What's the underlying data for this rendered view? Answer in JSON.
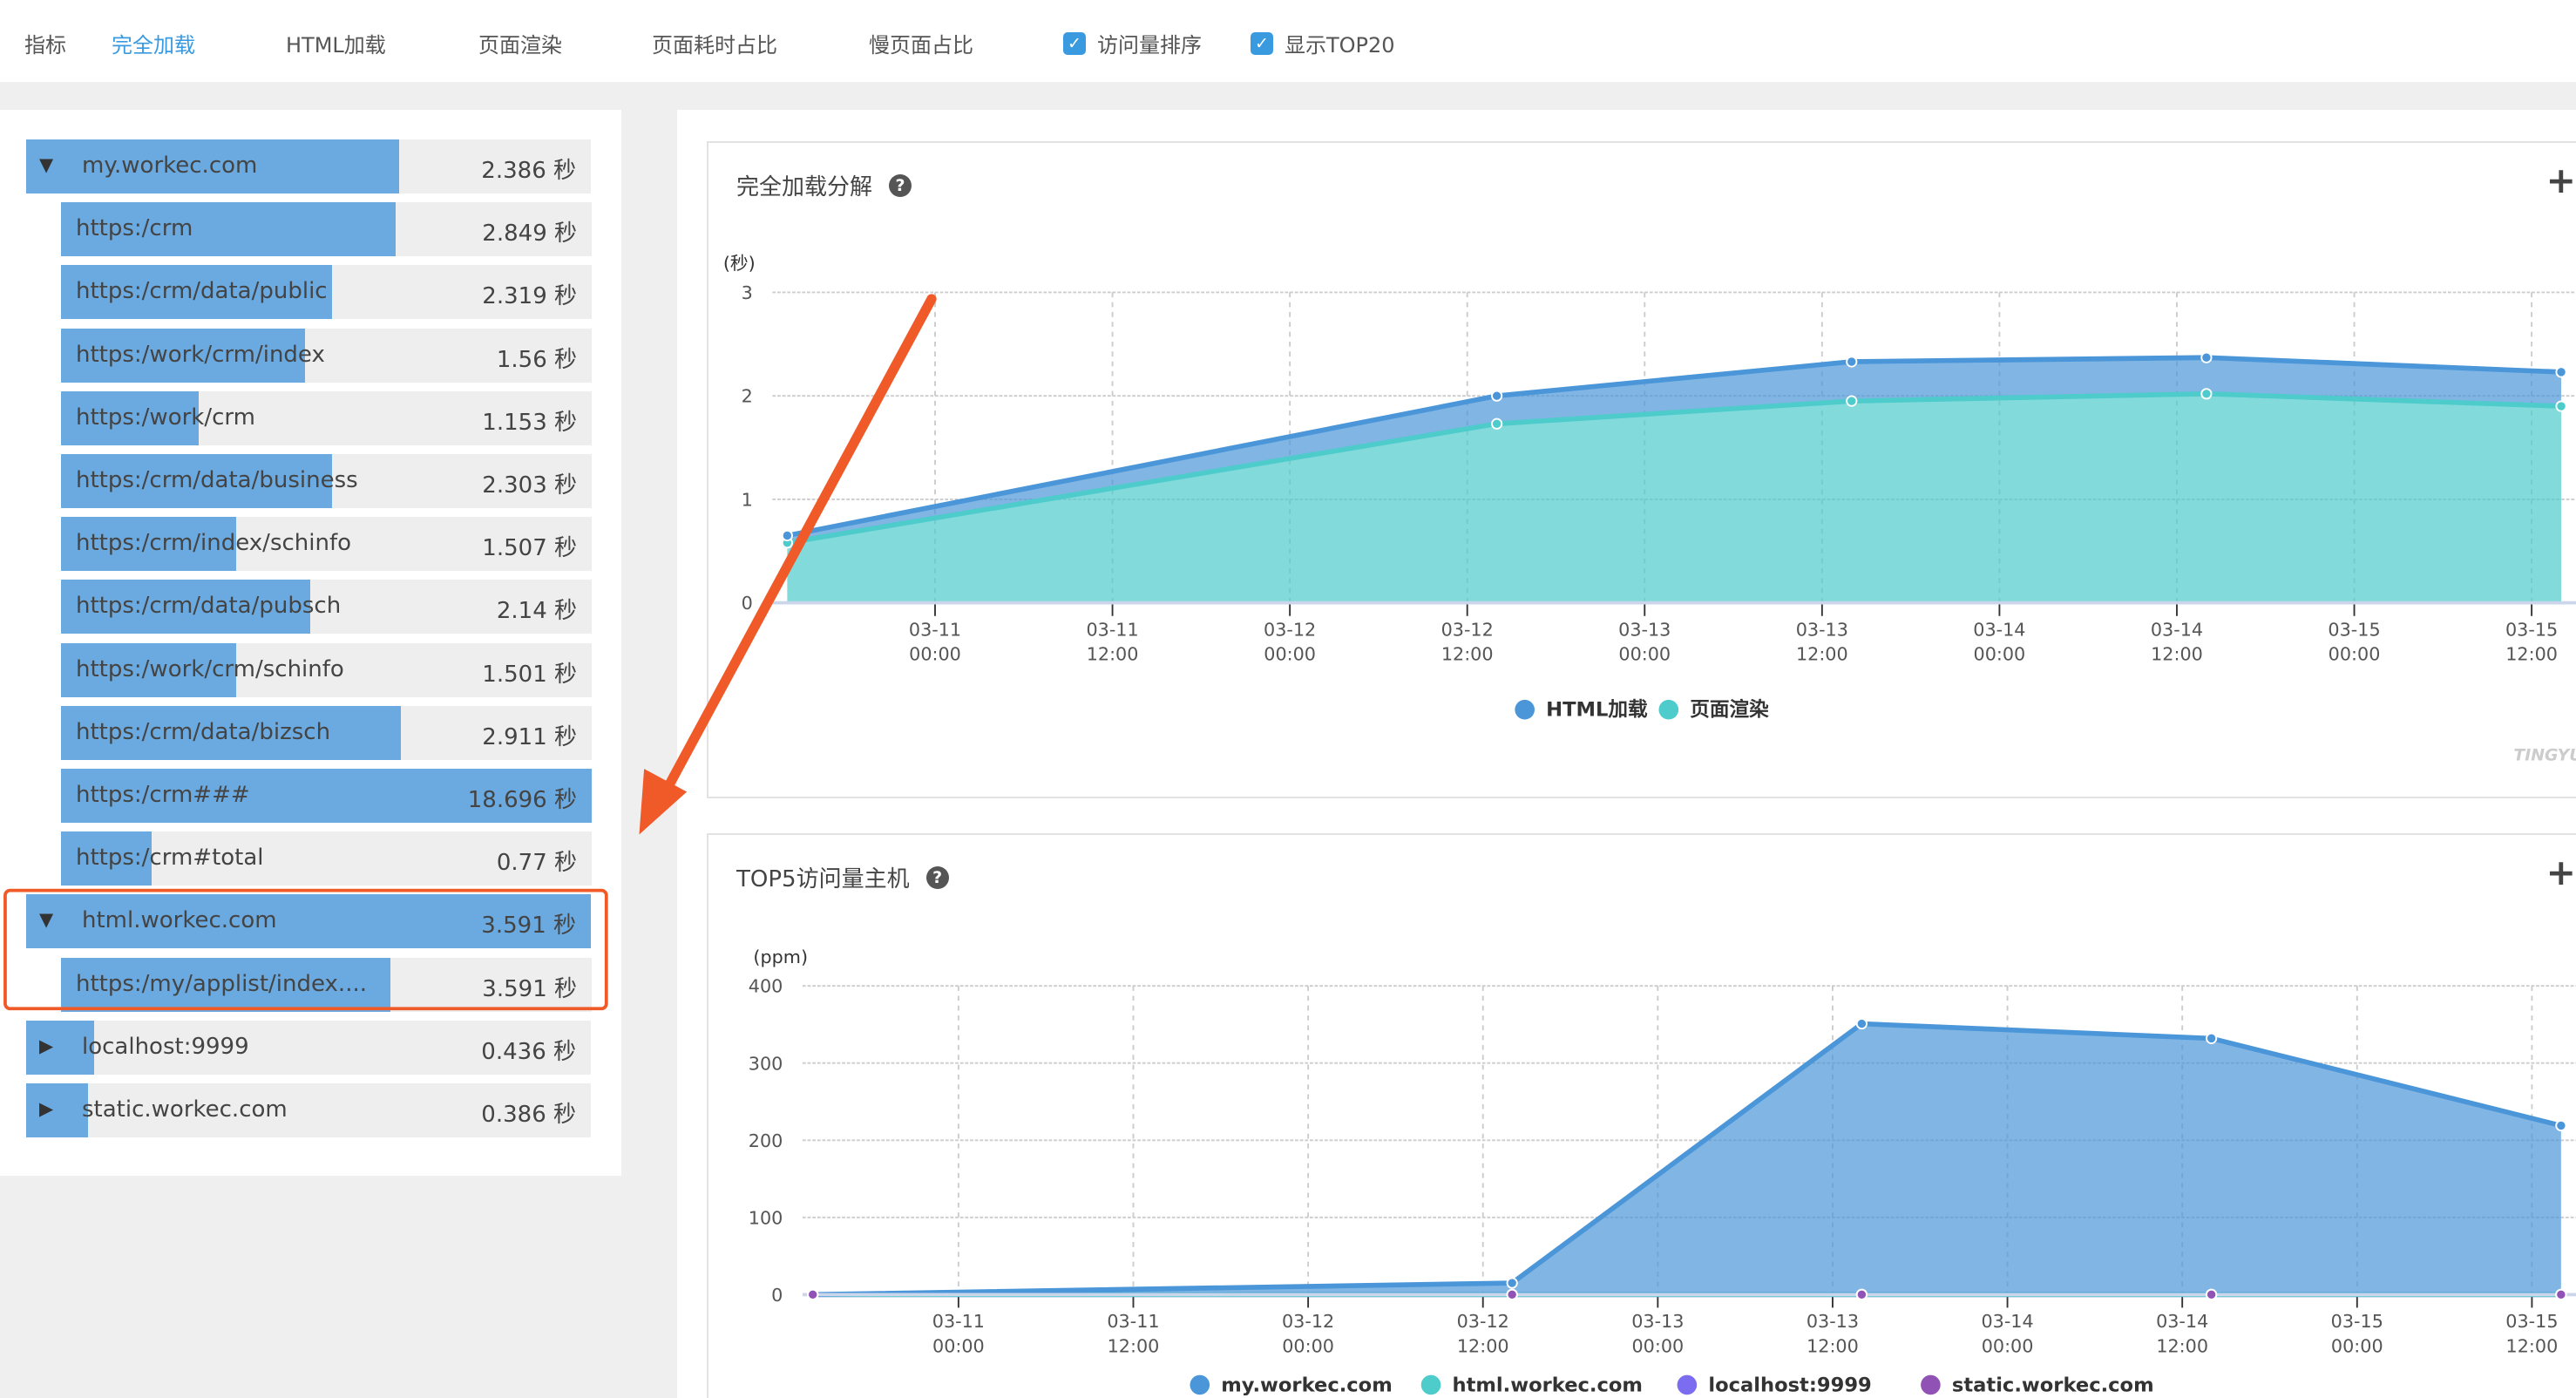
{
  "topbar": {
    "label": "指标",
    "tabs": [
      {
        "label": "完全加载",
        "active": true
      },
      {
        "label": "HTML加载"
      },
      {
        "label": "页面渲染"
      },
      {
        "label": "页面耗时占比"
      },
      {
        "label": "慢页面占比"
      }
    ],
    "checkboxes": [
      {
        "label": "访问量排序",
        "checked": true
      },
      {
        "label": "显示TOP20",
        "checked": true
      }
    ]
  },
  "tree": [
    {
      "label": "my.workec.com",
      "value": "2.386 秒",
      "bar_pct": 66,
      "expanded": true,
      "children": [
        {
          "label": "https:/crm",
          "value": "2.849 秒",
          "bar_pct": 63
        },
        {
          "label": "https:/crm/data/public",
          "value": "2.319 秒",
          "bar_pct": 51
        },
        {
          "label": "https:/work/crm/index",
          "value": "1.56 秒",
          "bar_pct": 46
        },
        {
          "label": "https:/work/crm",
          "value": "1.153 秒",
          "bar_pct": 26
        },
        {
          "label": "https:/crm/data/business",
          "value": "2.303 秒",
          "bar_pct": 51
        },
        {
          "label": "https:/crm/index/schinfo",
          "value": "1.507 秒",
          "bar_pct": 33
        },
        {
          "label": "https:/crm/data/pubsch",
          "value": "2.14 秒",
          "bar_pct": 47
        },
        {
          "label": "https:/work/crm/schinfo",
          "value": "1.501 秒",
          "bar_pct": 33
        },
        {
          "label": "https:/crm/data/bizsch",
          "value": "2.911 秒",
          "bar_pct": 64
        },
        {
          "label": "https:/crm###",
          "value": "18.696 秒",
          "bar_pct": 100
        },
        {
          "label": "https:/crm#total",
          "value": "0.77 秒",
          "bar_pct": 17
        }
      ]
    },
    {
      "label": "html.workec.com",
      "value": "3.591 秒",
      "bar_pct": 100,
      "expanded": true,
      "highlighted": true,
      "children": [
        {
          "label": "https:/my/applist/index....",
          "value": "3.591 秒",
          "bar_pct": 62
        }
      ]
    },
    {
      "label": "localhost:9999",
      "value": "0.436 秒",
      "bar_pct": 12,
      "expanded": false,
      "children": []
    },
    {
      "label": "static.workec.com",
      "value": "0.386 秒",
      "bar_pct": 11,
      "expanded": false,
      "children": []
    }
  ],
  "colors": {
    "accent": "#3a9ae0",
    "bar": "#6aaae0",
    "annotation": "#f05a28"
  },
  "chart_data": [
    {
      "type": "area",
      "title": "完全加载分解",
      "stacked": true,
      "ylabel": "(秒)",
      "ylim": [
        0,
        3
      ],
      "yticks": [
        "0",
        "1",
        "2",
        "3"
      ],
      "xticks": [
        "03-11 00:00",
        "03-11 12:00",
        "03-12 00:00",
        "03-12 12:00",
        "03-13 00:00",
        "03-13 12:00",
        "03-14 00:00",
        "03-14 12:00",
        "03-15 00:00",
        "03-15 12:00"
      ],
      "x": [
        "03-10 14:00",
        "03-12 14:00",
        "03-13 14:00",
        "03-14 14:00",
        "03-15 14:00"
      ],
      "series": [
        {
          "name": "页面渲染",
          "color": "#4ecbcb",
          "values": [
            0.58,
            1.73,
            1.95,
            2.02,
            1.9
          ]
        },
        {
          "name": "HTML加载",
          "color": "#4a96d8",
          "values": [
            0.07,
            0.27,
            0.38,
            0.35,
            0.33
          ]
        }
      ],
      "legend": [
        "HTML加载",
        "页面渲染"
      ],
      "legend_position": "bottom",
      "grid": true,
      "watermark": "TINGYUN"
    },
    {
      "type": "area",
      "title": "TOP5访问量主机",
      "ylabel": "(ppm)",
      "ylim": [
        0,
        400
      ],
      "yticks": [
        "0",
        "100",
        "200",
        "300",
        "400"
      ],
      "xticks": [
        "03-11 00:00",
        "03-11 12:00",
        "03-12 00:00",
        "03-12 12:00",
        "03-13 00:00",
        "03-13 12:00",
        "03-14 00:00",
        "03-14 12:00",
        "03-15 00:00",
        "03-15 12:00"
      ],
      "x": [
        "03-10 14:00",
        "03-12 14:00",
        "03-13 14:00",
        "03-14 14:00",
        "03-15 14:00"
      ],
      "series": [
        {
          "name": "my.workec.com",
          "color": "#4a96d8",
          "values": [
            0,
            15,
            351,
            332,
            219
          ]
        },
        {
          "name": "html.workec.com",
          "color": "#4ecbcb",
          "values": [
            0,
            0,
            0,
            0,
            0
          ]
        },
        {
          "name": "localhost:9999",
          "color": "#7b6cf0",
          "values": [
            0,
            0,
            0,
            0,
            0
          ]
        },
        {
          "name": "static.workec.com",
          "color": "#9152b5",
          "values": [
            0,
            0,
            0,
            0,
            0
          ]
        }
      ],
      "legend_position": "bottom",
      "grid": true
    }
  ]
}
